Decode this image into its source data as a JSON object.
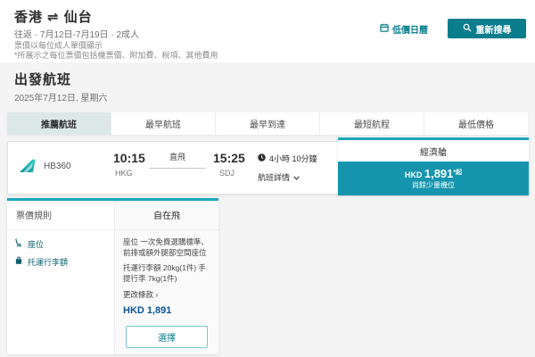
{
  "colors": {
    "accent_teal": "#0a7d8c",
    "panel_border_teal": "#1ba7bd",
    "price_box_teal": "#1595ad",
    "active_tab_bg": "#dbe8e6",
    "price_navy": "#0b5394"
  },
  "header": {
    "origin": "香港",
    "swap_icon": "⇌",
    "destination": "仙台",
    "trip_summary": "往返 · 7月12日-7月19日 · 2成人",
    "low_fare_calendar_label": "低價日曆",
    "search_again_label": "重新搜尋",
    "fare_note_line1": "票價以每位成人單價顯示",
    "fare_note_line2": "*所展示之每位票價包括機票價、附加費、稅項、其他費用"
  },
  "departure_section": {
    "title": "出發航班",
    "date": "2025年7月12日, 星期六"
  },
  "tabs": [
    {
      "label": "推薦航班",
      "active": true
    },
    {
      "label": "最早航班",
      "active": false
    },
    {
      "label": "最早到達",
      "active": false
    },
    {
      "label": "最短航程",
      "active": false
    },
    {
      "label": "最低價格",
      "active": false
    }
  ],
  "flight": {
    "number": "HB360",
    "depart_time": "10:15",
    "depart_airport": "HKG",
    "stop_type": "直飛",
    "arrive_time": "15:25",
    "arrive_airport": "SDJ",
    "duration": "4小時 10分鐘",
    "details_label": "航班詳情",
    "cabin_name": "經濟艙",
    "price_currency": "HKD",
    "price_amount": "1,891",
    "price_suffix": "*起",
    "availability": "尚餘少量機位"
  },
  "fare_panel": {
    "rules_header": "票價規則",
    "brand_name": "自在飛",
    "features": [
      {
        "label": "座位"
      },
      {
        "label": "托運行李額"
      }
    ],
    "seat_detail": "座位 一次免費選購標準、前排或額外腿部空間座位",
    "baggage_detail": "托運行李額 20kg(1件) 手提行李 7kg(1件)",
    "change_terms_label": "更改條款",
    "change_terms_arrow": "›",
    "total_price": "HKD 1,891",
    "select_button_label": "選擇"
  }
}
